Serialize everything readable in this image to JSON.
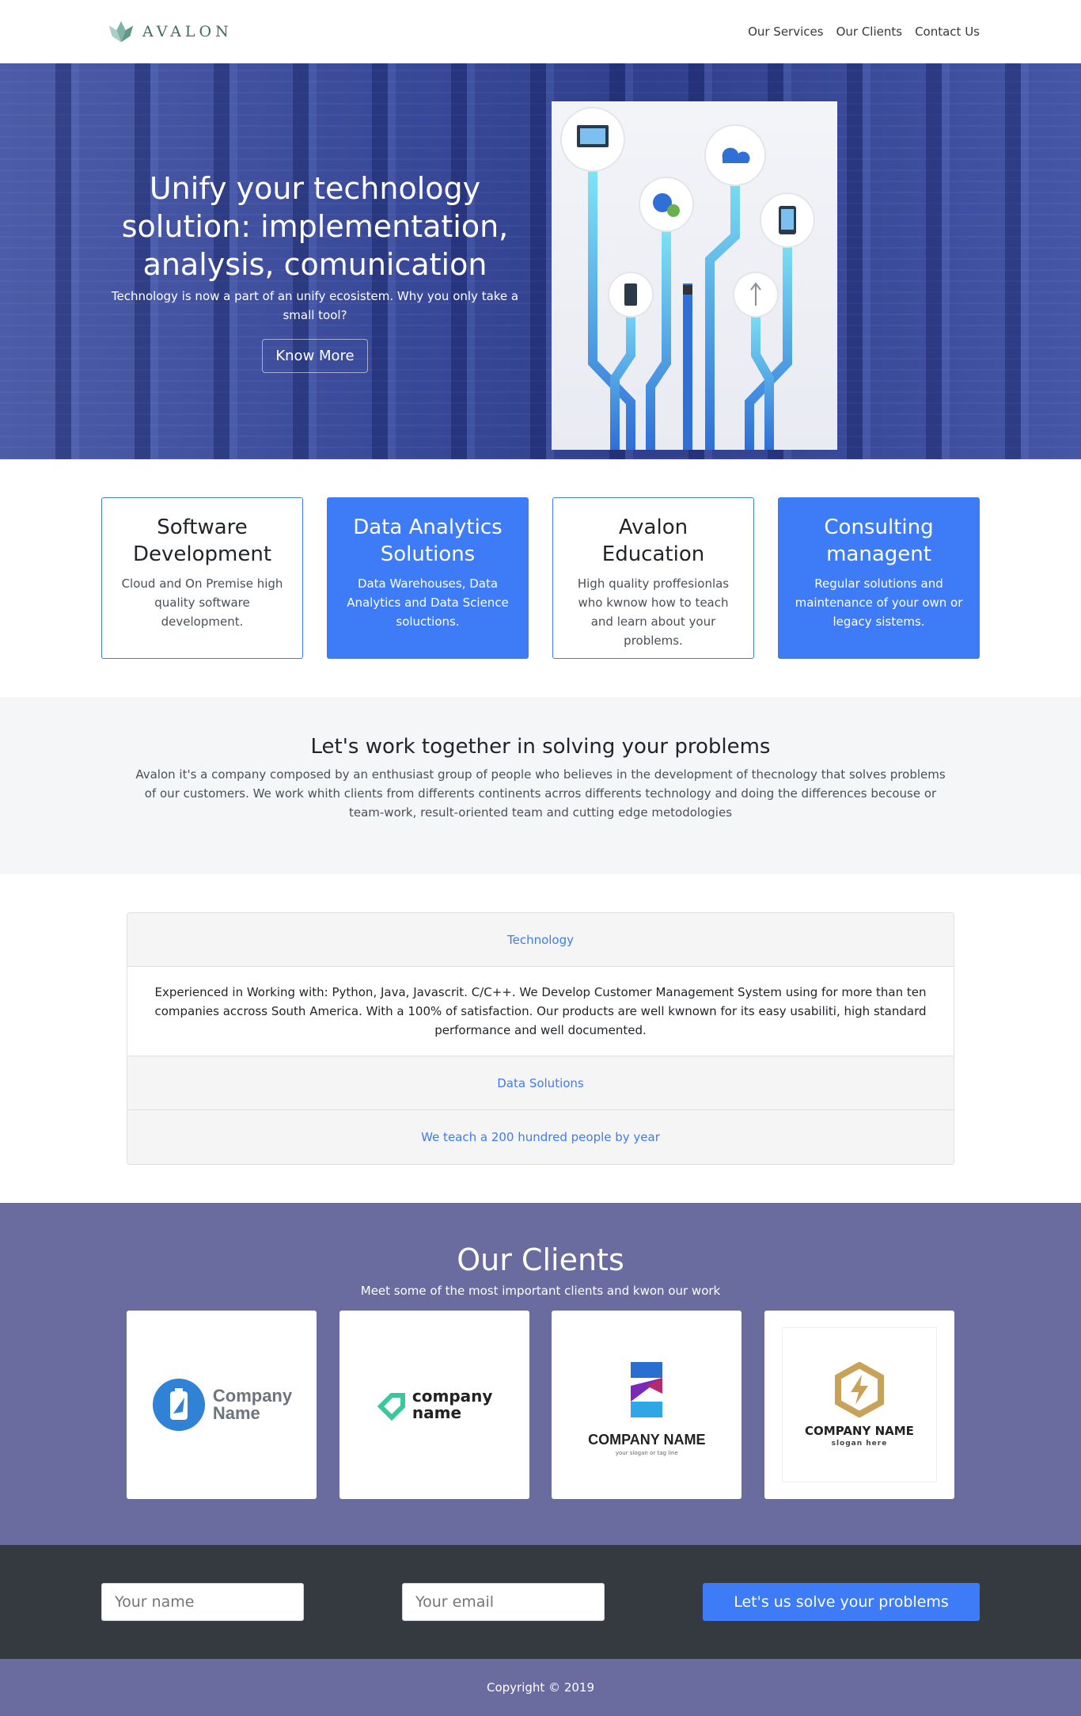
{
  "brand": {
    "name": "AVALON"
  },
  "nav": {
    "items": [
      "Our Services",
      "Our Clients",
      "Contact Us"
    ]
  },
  "hero": {
    "title": "Unify your technology solution: implementation, analysis, comunication",
    "subtitle": "Technology is now a part of an unify ecosistem. Why you only take a small tool?",
    "button": "Know More"
  },
  "services": [
    {
      "title": "Software Development",
      "desc": "Cloud and On Premise high quality software development."
    },
    {
      "title": "Data Analytics Solutions",
      "desc": "Data Warehouses, Data Analytics and Data Science soluctions."
    },
    {
      "title": "Avalon Education",
      "desc": "High quality proffesionlas who kwnow how to teach and learn about your problems."
    },
    {
      "title": "Consulting managent",
      "desc": "Regular solutions and maintenance of your own or legacy sistems."
    }
  ],
  "about": {
    "title": "Let's work together in solving your problems",
    "text": "Avalon it's a company composed by an enthusiast group of people who believes in the development of thecnology that solves problems of our customers. We work whith clients from differents continents acrros differents technology and doing the differences becouse or team-work, result-oriented team and cutting edge metodologies"
  },
  "accordion": {
    "items": [
      {
        "header": "Technology",
        "body": "Experienced in Working with: Python, Java, Javascrit. C/C++. We Develop Customer Management System using for more than ten companies accross South America. With a 100% of satisfaction. Our products are well kwnown for its easy usabiliti, high standard performance and well documented."
      },
      {
        "header": "Data Solutions"
      },
      {
        "header": "We teach a 200 hundred people by year"
      }
    ]
  },
  "clients": {
    "title": "Our Clients",
    "subtitle": "Meet some of the most important clients and kwon our work",
    "logos": [
      {
        "line1": "Company",
        "line2": "Name"
      },
      {
        "line1": "company",
        "line2": "name"
      },
      {
        "line1": "COMPANY NAME",
        "line2": "your slogan or tag line"
      },
      {
        "line1": "COMPANY NAME",
        "line2": "slogan here"
      }
    ]
  },
  "form": {
    "name_placeholder": "Your name",
    "email_placeholder": "Your email",
    "button": "Let's us solve your problems"
  },
  "footer": {
    "text": "Copyright © 2019"
  },
  "colors": {
    "primary": "#3d7bf7",
    "purple": "#6a6b9f",
    "dark": "#343a40"
  }
}
